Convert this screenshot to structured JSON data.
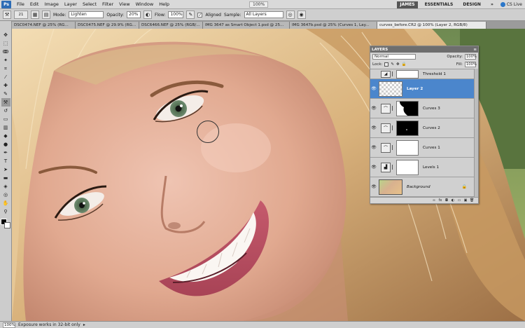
{
  "menubar": {
    "logo": "Ps",
    "items": [
      "File",
      "Edit",
      "Image",
      "Layer",
      "Select",
      "Filter",
      "View",
      "Window",
      "Help"
    ],
    "zoom": "100%",
    "workspaces": [
      "JAMES",
      "ESSENTIALS",
      "DESIGN"
    ],
    "more": "»",
    "cs_live": "CS Live"
  },
  "options": {
    "brush_size": "21",
    "mode_label": "Mode:",
    "mode_value": "Lighten",
    "opacity_label": "Opacity:",
    "opacity_value": "20%",
    "flow_label": "Flow:",
    "flow_value": "100%",
    "aligned_label": "Aligned",
    "sample_label": "Sample:",
    "sample_value": "All Layers"
  },
  "tabs": [
    "DSC0474.NEF @ 25% (RG...",
    "DSC0475.NEF @ 29.9% (RG...",
    "DSC6466.NEF @ 25% (RGB/...",
    "IMG 3647 as Smart Object 1.psd @ 25...",
    "IMG 3647b.psd @ 25% (Curves 1, Lay...",
    "curves_before.CR2 @ 100% (Layer 2, RGB/8)"
  ],
  "statusbar": {
    "zoom": "100%",
    "message": "Exposure works in 32-bit only"
  },
  "layers_panel": {
    "title": "LAYERS",
    "blend_mode": "Normal",
    "opacity_label": "Opacity:",
    "opacity_value": "100%",
    "lock_label": "Lock:",
    "fill_label": "Fill:",
    "fill_value": "100%",
    "layers": [
      {
        "name": "Threshold 1",
        "type": "adjustment",
        "mask": "white",
        "partial": true
      },
      {
        "name": "Layer 2",
        "type": "pixel",
        "selected": true
      },
      {
        "name": "Curves 3",
        "type": "adjustment",
        "mask": "black-partial"
      },
      {
        "name": "Curves 2",
        "type": "adjustment",
        "mask": "black"
      },
      {
        "name": "Curves 1",
        "type": "adjustment",
        "mask": "white"
      },
      {
        "name": "Levels 1",
        "type": "adjustment",
        "mask": "white"
      },
      {
        "name": "Background",
        "type": "background",
        "locked": true
      }
    ]
  },
  "colors": {
    "selection": "#4b86cc",
    "panel": "#d6d6d6",
    "chrome": "#cfcfcf"
  }
}
